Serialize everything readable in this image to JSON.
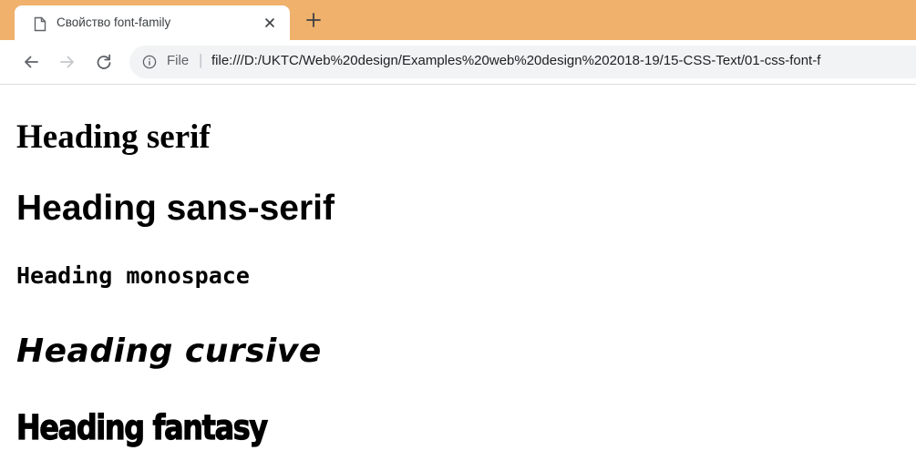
{
  "browser": {
    "tab": {
      "title": "Свойство font-family",
      "icon": "document-icon",
      "close_icon": "close-icon"
    },
    "new_tab_icon": "plus-icon",
    "tabstrip_color": "#efb16b",
    "toolbar": {
      "back_icon": "arrow-left-icon",
      "forward_icon": "arrow-right-icon",
      "reload_icon": "reload-icon"
    },
    "omnibox": {
      "info_icon": "info-icon",
      "scheme": "File",
      "separator": "|",
      "url": "file:///D:/UKTC/Web%20design/Examples%20web%20design%202018-19/15-CSS-Text/01-css-font-f"
    }
  },
  "page": {
    "headings": [
      {
        "text": "Heading serif"
      },
      {
        "text": "Heading sans-serif"
      },
      {
        "text": "Heading monospace"
      },
      {
        "text": "Heading cursive"
      },
      {
        "text": "Heading fantasy"
      }
    ]
  }
}
